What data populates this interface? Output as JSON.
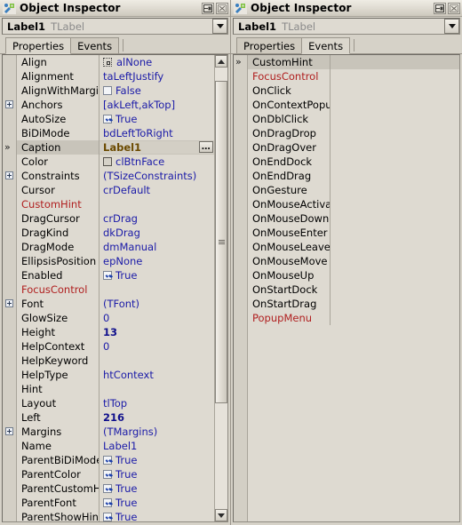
{
  "window": {
    "title": "Object Inspector",
    "icon": "object-inspector-icon",
    "buttons": [
      {
        "name": "dock-button",
        "glyph": "dock"
      },
      {
        "name": "close-button",
        "glyph": "close"
      }
    ]
  },
  "left_panel": {
    "object_selector": {
      "name": "Label1",
      "type": "TLabel",
      "dropdown": "chevron-down-icon"
    },
    "tabs": [
      {
        "label": "Properties",
        "active": true
      },
      {
        "label": "Events",
        "active": false
      }
    ],
    "active_tab": "Properties",
    "rows": [
      {
        "name": "Align",
        "value": "alNone",
        "glyph": "box",
        "expander": false,
        "selected": false
      },
      {
        "name": "Alignment",
        "value": "taLeftJustify",
        "glyph": "none",
        "expander": false,
        "selected": false
      },
      {
        "name": "AlignWithMargins",
        "value": "False",
        "glyph": "checkbox-off",
        "expander": false,
        "selected": false
      },
      {
        "name": "Anchors",
        "value": "[akLeft,akTop]",
        "glyph": "none",
        "expander": true,
        "selected": false
      },
      {
        "name": "AutoSize",
        "value": "True",
        "glyph": "checkbox-on",
        "expander": false,
        "selected": false
      },
      {
        "name": "BiDiMode",
        "value": "bdLeftToRight",
        "glyph": "none",
        "expander": false,
        "selected": false
      },
      {
        "name": "Caption",
        "value": "Label1",
        "glyph": "none",
        "expander": false,
        "selected": true,
        "has_ellipsis": true
      },
      {
        "name": "Color",
        "value": "clBtnFace",
        "glyph": "swatch",
        "expander": false,
        "selected": false
      },
      {
        "name": "Constraints",
        "value": "(TSizeConstraints)",
        "glyph": "none",
        "expander": true,
        "selected": false
      },
      {
        "name": "Cursor",
        "value": "crDefault",
        "glyph": "none",
        "expander": false,
        "selected": false
      },
      {
        "name": "CustomHint",
        "value": "",
        "glyph": "none",
        "expander": false,
        "selected": false,
        "red": true
      },
      {
        "name": "DragCursor",
        "value": "crDrag",
        "glyph": "none",
        "expander": false,
        "selected": false
      },
      {
        "name": "DragKind",
        "value": "dkDrag",
        "glyph": "none",
        "expander": false,
        "selected": false
      },
      {
        "name": "DragMode",
        "value": "dmManual",
        "glyph": "none",
        "expander": false,
        "selected": false
      },
      {
        "name": "EllipsisPosition",
        "value": "epNone",
        "glyph": "none",
        "expander": false,
        "selected": false
      },
      {
        "name": "Enabled",
        "value": "True",
        "glyph": "checkbox-on",
        "expander": false,
        "selected": false
      },
      {
        "name": "FocusControl",
        "value": "",
        "glyph": "none",
        "expander": false,
        "selected": false,
        "red": true
      },
      {
        "name": "Font",
        "value": "(TFont)",
        "glyph": "none",
        "expander": true,
        "selected": false
      },
      {
        "name": "GlowSize",
        "value": "0",
        "glyph": "none",
        "expander": false,
        "selected": false
      },
      {
        "name": "Height",
        "value": "13",
        "glyph": "none",
        "expander": false,
        "selected": false,
        "bold": true
      },
      {
        "name": "HelpContext",
        "value": "0",
        "glyph": "none",
        "expander": false,
        "selected": false
      },
      {
        "name": "HelpKeyword",
        "value": "",
        "glyph": "none",
        "expander": false,
        "selected": false
      },
      {
        "name": "HelpType",
        "value": "htContext",
        "glyph": "none",
        "expander": false,
        "selected": false
      },
      {
        "name": "Hint",
        "value": "",
        "glyph": "none",
        "expander": false,
        "selected": false
      },
      {
        "name": "Layout",
        "value": "tlTop",
        "glyph": "none",
        "expander": false,
        "selected": false
      },
      {
        "name": "Left",
        "value": "216",
        "glyph": "none",
        "expander": false,
        "selected": false,
        "bold": true
      },
      {
        "name": "Margins",
        "value": "(TMargins)",
        "glyph": "none",
        "expander": true,
        "selected": false
      },
      {
        "name": "Name",
        "value": "Label1",
        "glyph": "none",
        "expander": false,
        "selected": false
      },
      {
        "name": "ParentBiDiMode",
        "value": "True",
        "glyph": "checkbox-on",
        "expander": false,
        "selected": false
      },
      {
        "name": "ParentColor",
        "value": "True",
        "glyph": "checkbox-on",
        "expander": false,
        "selected": false
      },
      {
        "name": "ParentCustomHint",
        "value": "True",
        "glyph": "checkbox-on",
        "expander": false,
        "selected": false
      },
      {
        "name": "ParentFont",
        "value": "True",
        "glyph": "checkbox-on",
        "expander": false,
        "selected": false
      },
      {
        "name": "ParentShowHint",
        "value": "True",
        "glyph": "checkbox-on",
        "expander": false,
        "selected": false
      }
    ],
    "scrollbar": {
      "up_arrow": "scroll-up-icon",
      "down_arrow": "scroll-down-icon",
      "thumb_top_pct": 3,
      "thumb_height_pct": 73
    }
  },
  "right_panel": {
    "object_selector": {
      "name": "Label1",
      "type": "TLabel",
      "dropdown": "chevron-down-icon"
    },
    "tabs": [
      {
        "label": "Properties",
        "active": false
      },
      {
        "label": "Events",
        "active": true
      }
    ],
    "active_tab": "Events",
    "editor_value": "",
    "rows": [
      {
        "name": "CustomHint",
        "value": "",
        "selected": true,
        "editor": true
      },
      {
        "name": "FocusControl",
        "value": "",
        "red": true
      },
      {
        "name": "OnClick",
        "value": ""
      },
      {
        "name": "OnContextPopup",
        "value": ""
      },
      {
        "name": "OnDblClick",
        "value": ""
      },
      {
        "name": "OnDragDrop",
        "value": ""
      },
      {
        "name": "OnDragOver",
        "value": ""
      },
      {
        "name": "OnEndDock",
        "value": ""
      },
      {
        "name": "OnEndDrag",
        "value": ""
      },
      {
        "name": "OnGesture",
        "value": ""
      },
      {
        "name": "OnMouseActivate",
        "value": ""
      },
      {
        "name": "OnMouseDown",
        "value": ""
      },
      {
        "name": "OnMouseEnter",
        "value": ""
      },
      {
        "name": "OnMouseLeave",
        "value": ""
      },
      {
        "name": "OnMouseMove",
        "value": ""
      },
      {
        "name": "OnMouseUp",
        "value": ""
      },
      {
        "name": "OnStartDock",
        "value": ""
      },
      {
        "name": "OnStartDrag",
        "value": ""
      },
      {
        "name": "PopupMenu",
        "value": "",
        "red": true
      }
    ]
  },
  "colors": {
    "value_blue": "#1b1ba8",
    "event_red": "#b02020",
    "selected_value": "#6b4a00",
    "panel_bg": "#d6d2c8",
    "grid_bg": "#dedad1"
  }
}
